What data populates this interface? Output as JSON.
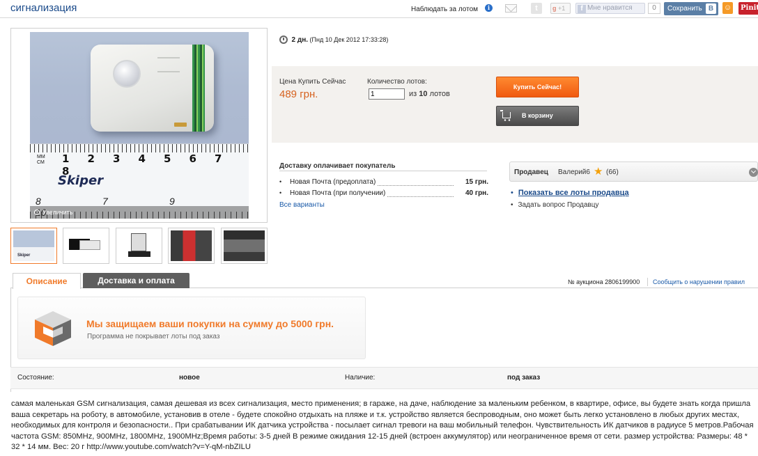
{
  "header": {
    "title": "сигнализация",
    "watch_label": "Наблюдать за лотом",
    "gplus_label": "+1",
    "gplus_prefix": "g",
    "fb_like_label": "Мне нравится",
    "fb_like_count": "0",
    "vk_save_label": "Сохранить",
    "vk_badge": "В",
    "pinterest_label": "Pinit"
  },
  "photo": {
    "zoom_label": "Увеличить",
    "ruler_brand": "Skiper",
    "ruler_unit_top": "MM",
    "ruler_unit_bottom": "СМ",
    "ruler_numbers": [
      "1",
      "2",
      "3",
      "4",
      "5",
      "6",
      "7",
      "8"
    ],
    "ruler_numbers_bottom": [
      "8",
      "7",
      "9",
      "10"
    ]
  },
  "thumbnails": [
    "thumb-1",
    "thumb-2",
    "thumb-3",
    "thumb-4",
    "thumb-5"
  ],
  "timer": {
    "remaining": "2 дн.",
    "end_date": "(Пнд 10 Дек 2012 17:33:28)"
  },
  "buy": {
    "price_label": "Цена Купить Сейчас",
    "price": "489 грн.",
    "qty_label": "Количество лотов:",
    "qty_value": "1",
    "qty_of_prefix": "из",
    "qty_total": "10",
    "qty_of_suffix": "лотов",
    "buy_now_label": "Купить Сейчас!",
    "cart_label": "В корзину"
  },
  "delivery": {
    "title": "Доставку оплачивает покупатель",
    "options": [
      {
        "label": "Новая Почта (предоплата)",
        "price": "15 грн."
      },
      {
        "label": "Новая Почта (при получении)",
        "price": "40 грн."
      }
    ],
    "all_variants": "Все варианты"
  },
  "seller": {
    "label": "Продавец",
    "name": "Валерий6",
    "rating": "(66)",
    "show_all_lots": "Показать все лоты продавца",
    "ask_question": "Задать вопрос Продавцу"
  },
  "tabs": [
    {
      "label": "Описание"
    },
    {
      "label": "Доставка и оплата"
    }
  ],
  "auction": {
    "number": "№ аукциона 2806199900",
    "report": "Сообщить о нарушении правил"
  },
  "protection": {
    "title": "Мы защищаем ваши покупки на сумму до 5000 грн.",
    "subtitle": "Программа не покрывает лоты под заказ"
  },
  "conditions": {
    "state_label": "Состояние:",
    "state_value": "новое",
    "availability_label": "Наличие:",
    "availability_value": "под заказ"
  },
  "description": "самая маленькая GSM сигнализация, самая дешевая из всех сигнализация, место применения; в гараже, на даче, наблюдение за маленьким ребенком, в квартире, офисе, вы будете знать когда пришла ваша секретарь на роботу, в автомобиле, установив в отеле - будете спокойно отдыхать на пляже и т.к. устройство является беспроводным, оно может быть легко установлено в любых других местах, необходимых для контроля и безопасности.. При срабатывании ИК датчика устройства - посылает сигнал тревоги на ваш мобильный телефон. Чувствительность ИК датчиков в радиусе 5 метров.Рабочая частота GSM: 850MHz, 900MHz, 1800MHz, 1900MHz;Время работы: 3-5 дней В режиме ожидания 12-15 дней (встроен аккумулятор) или неограниченное время от сети. размер устройства: Размеры: 48 * 32 * 14 мм. Вес: 20 г http://www.youtube.com/watch?v=Y-qM-nbZILU"
}
